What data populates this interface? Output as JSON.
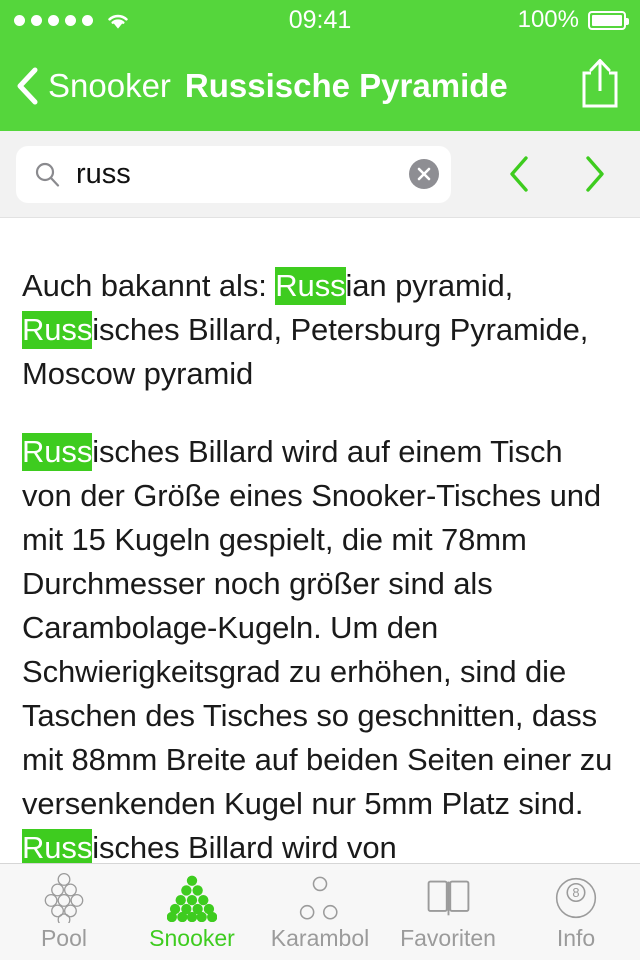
{
  "theme": {
    "bar_green": "#55D63C",
    "accent_green": "#3ECC1F",
    "highlight_bg": "#3ECC1F",
    "inactive_gray": "#9B9B9B",
    "search_bg": "#F2F2F2",
    "tabbar_bg": "#F7F7F7"
  },
  "statusbar": {
    "signal_icon": "signal-dots-icon",
    "signal_dots": 5,
    "wifi_icon": "wifi-icon",
    "time": "09:41",
    "battery_percent": "100%",
    "battery_icon": "battery-full-icon"
  },
  "navbar": {
    "back_icon": "chevron-left-icon",
    "back_label": "Snooker",
    "title": "Russische Pyramide",
    "share_icon": "share-icon"
  },
  "search": {
    "icon": "search-icon",
    "value": "russ",
    "placeholder": "Suchen",
    "clear_icon": "clear-circle-icon",
    "prev_icon": "chevron-left-icon",
    "next_icon": "chevron-right-icon"
  },
  "content": {
    "paragraphs": [
      {
        "segments": [
          {
            "text": "Auch bakannt als: ",
            "highlight": false
          },
          {
            "text": "Russ",
            "highlight": true
          },
          {
            "text": "ian pyramid, ",
            "highlight": false
          },
          {
            "text": "Russ",
            "highlight": true
          },
          {
            "text": "isches Billard, Petersburg Pyramide, Moscow pyramid",
            "highlight": false
          }
        ]
      },
      {
        "segments": [
          {
            "text": "Russ",
            "highlight": true
          },
          {
            "text": "isches Billard wird auf einem Tisch von der Größe eines Snooker-Tisches und mit 15 Kugeln gespielt, die mit 78mm Durchmesser noch größer sind als Carambolage-Kugeln. Um den Schwierigkeitsgrad zu erhöhen, sind die Taschen des Tisches so geschnitten, dass mit 88mm Breite auf beiden Seiten einer zu versenkenden Kugel nur 5mm Platz sind. ",
            "highlight": false
          },
          {
            "text": "Russ",
            "highlight": true
          },
          {
            "text": "isches Billard wird von",
            "highlight": false
          }
        ]
      }
    ]
  },
  "tabbar": {
    "tabs": [
      {
        "label": "Pool",
        "icon": "pool-rack-diamond-icon",
        "active": false
      },
      {
        "label": "Snooker",
        "icon": "snooker-rack-triangle-icon",
        "active": true
      },
      {
        "label": "Karambol",
        "icon": "carom-three-balls-icon",
        "active": false
      },
      {
        "label": "Favoriten",
        "icon": "open-book-icon",
        "active": false
      },
      {
        "label": "Info",
        "icon": "eight-ball-icon",
        "active": false
      }
    ]
  }
}
